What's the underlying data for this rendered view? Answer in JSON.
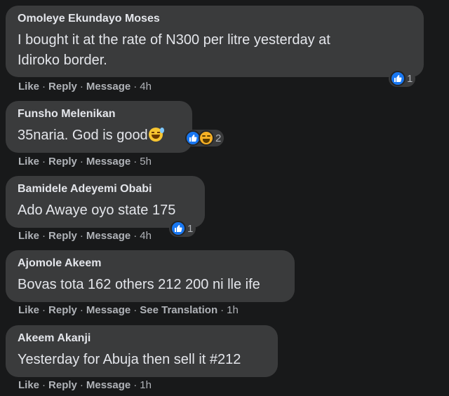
{
  "comments": [
    {
      "author": "Omoleye Ekundayo Moses",
      "text_lines": [
        "I bought it at the rate of N300 per litre yesterday at",
        "Idiroko border."
      ],
      "actions": {
        "like": "Like",
        "reply": "Reply",
        "message": "Message",
        "time": "4h"
      },
      "reactions": {
        "icons": [
          "like-icon"
        ],
        "count": "1"
      }
    },
    {
      "author": "Funsho Melenikan",
      "text_lines": [
        "35naria. God is good"
      ],
      "inline_emoji": "sweat-smile-emoji",
      "actions": {
        "like": "Like",
        "reply": "Reply",
        "message": "Message",
        "time": "5h"
      },
      "reactions": {
        "icons": [
          "like-icon",
          "haha-icon"
        ],
        "count": "2"
      }
    },
    {
      "author": "Bamidele Adeyemi Obabi",
      "text_lines": [
        "Ado Awaye oyo state 175"
      ],
      "actions": {
        "like": "Like",
        "reply": "Reply",
        "message": "Message",
        "time": "4h"
      },
      "reactions": {
        "icons": [
          "like-icon"
        ],
        "count": "1"
      }
    },
    {
      "author": "Ajomole Akeem",
      "text_lines": [
        "Bovas tota 162 others 212 200 ni lle ife"
      ],
      "actions": {
        "like": "Like",
        "reply": "Reply",
        "message": "Message",
        "see_translation": "See Translation",
        "time": "1h"
      }
    },
    {
      "author": "Akeem Akanji",
      "text_lines": [
        "Yesterday for Abuja then sell it #212"
      ],
      "actions": {
        "like": "Like",
        "reply": "Reply",
        "message": "Message",
        "time": "1h"
      }
    }
  ],
  "colors": {
    "background": "#18191a",
    "bubble": "#3a3b3c",
    "text": "#e4e6eb",
    "meta": "#b0b3b8",
    "like_blue": "#1877f2",
    "haha_yellow": "#f7b125"
  }
}
